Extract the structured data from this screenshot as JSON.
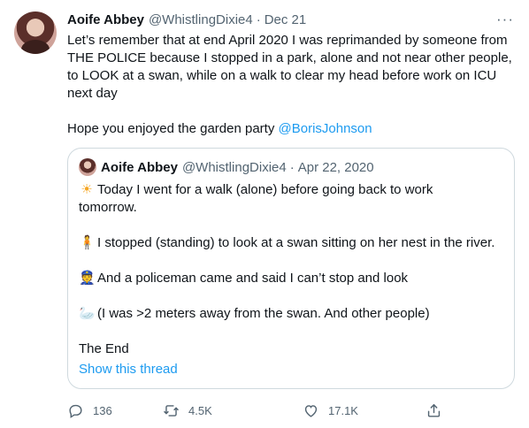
{
  "tweet": {
    "author_name": "Aoife Abbey",
    "handle": "@WhistlingDixie4",
    "separator": "·",
    "date": "Dec 21",
    "more_label": "···",
    "paragraph1": "Let’s remember that at end April 2020 I was reprimanded by someone from\nTHE POLICE because I stopped in a park, alone and not near other people,\nto LOOK at a swan, while on a walk to clear my head before work on ICU\nnext day",
    "paragraph2_text": "Hope you enjoyed the garden party ",
    "paragraph2_mention": "@BorisJohnson"
  },
  "quote": {
    "author_name": "Aoife Abbey",
    "handle": "@WhistlingDixie4",
    "separator": "·",
    "date": "Apr 22, 2020",
    "line1_emoji": "☀",
    "line1": "Today I went for a walk (alone) before going back to work",
    "line1b": "tomorrow.",
    "line2_emoji": "🧍",
    "line2": "I stopped (standing) to look at a swan sitting on her nest in the river.",
    "line3_emoji": "👮",
    "line3": "And a policeman came and said I can’t stop and look",
    "line4_emoji": "🦢",
    "line4": "(I was >2 meters away from the swan. And other people)",
    "line5": "The End",
    "show_thread": "Show this thread"
  },
  "actions": {
    "replies": "136",
    "retweets": "4.5K",
    "likes": "17.1K"
  },
  "icons": {
    "reply": "reply-icon",
    "retweet": "retweet-icon",
    "like": "heart-icon",
    "share": "share-icon"
  },
  "colors": {
    "link": "#1d9bf0",
    "secondary": "#536471",
    "border": "#cfd9de"
  }
}
